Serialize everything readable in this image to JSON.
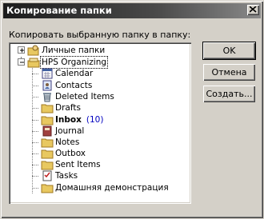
{
  "window": {
    "title": "Копирование папки"
  },
  "prompt": "Копировать выбранную папку в папку:",
  "tree": [
    {
      "label": "Личные папки",
      "icon": "personal-folders-icon",
      "expander": "+"
    },
    {
      "label": "HPS Organizing",
      "icon": "mailbox-icon",
      "expander": "-",
      "selected": true
    },
    {
      "label": "Calendar",
      "icon": "calendar-icon"
    },
    {
      "label": "Contacts",
      "icon": "contacts-icon"
    },
    {
      "label": "Deleted Items",
      "icon": "deleted-items-icon"
    },
    {
      "label": "Drafts",
      "icon": "drafts-icon"
    },
    {
      "label": "Inbox",
      "icon": "inbox-icon",
      "bold": true,
      "count": "(10)"
    },
    {
      "label": "Journal",
      "icon": "journal-icon"
    },
    {
      "label": "Notes",
      "icon": "notes-icon"
    },
    {
      "label": "Outbox",
      "icon": "outbox-icon"
    },
    {
      "label": "Sent Items",
      "icon": "sent-items-icon"
    },
    {
      "label": "Tasks",
      "icon": "tasks-icon"
    },
    {
      "label": "Домашняя демонстрация",
      "icon": "folder-icon"
    }
  ],
  "buttons": {
    "ok": "OK",
    "cancel": "Отмена",
    "create": "Создать..."
  },
  "colors": {
    "folder": "#e8c860",
    "titlebar": "#2a2a2a",
    "count": "#0000c0"
  }
}
